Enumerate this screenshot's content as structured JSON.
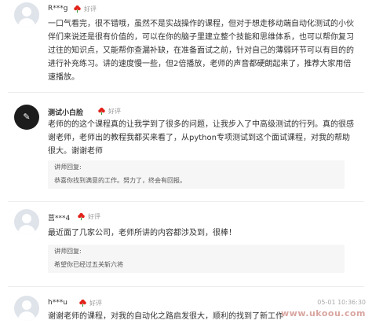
{
  "reviews": [
    {
      "user": "R***g",
      "rating": "好评",
      "content": "一口气看完，很不错哦，虽然不是实战操作的课程，但对于想走移动端自动化测试的小伙伴们来说还是很有价值的，可以在你的脑子里建立整个技能和思维体系，也可以帮你复习过往的知识点，又能帮你查漏补缺，在准备面试之前，针对自己的薄弱环节可以有目的的进行补充练习。讲的速度慢一些，但2倍播放，老师的声音都硬朗起来了，推荐大家用倍速播放。"
    },
    {
      "user": "测试小白脸",
      "rating": "好评",
      "content": "老师的的这个课程真的让我学到了很多的问题，让我步入了中高级测试的行列。真的很感谢老师，老师出的教程我都买来看了，从python专项测试到这个面试课程，对我的帮助很大。谢谢老师",
      "reply_label": "讲师回复:",
      "reply_text": "恭喜你找到满意的工作。努力了，终会有回报。"
    },
    {
      "user": "莒***4",
      "rating": "好评",
      "content": "最近面了几家公司，老师所讲的内容都涉及到，很棒！",
      "reply_label": "讲师回复:",
      "reply_text": "希望你已经过五关斩六将"
    },
    {
      "user": "h***u",
      "rating": "好评",
      "date": "05-01 10:36:30",
      "content": "谢谢老师的课程，对我的自动化之路启发很大，顺利的找到了新工作"
    }
  ],
  "watermark": "www.ukoou.com",
  "colors": {
    "badge_flower": "#e2231a",
    "reply_bg": "#f6f6f6",
    "divider": "#ececec"
  }
}
